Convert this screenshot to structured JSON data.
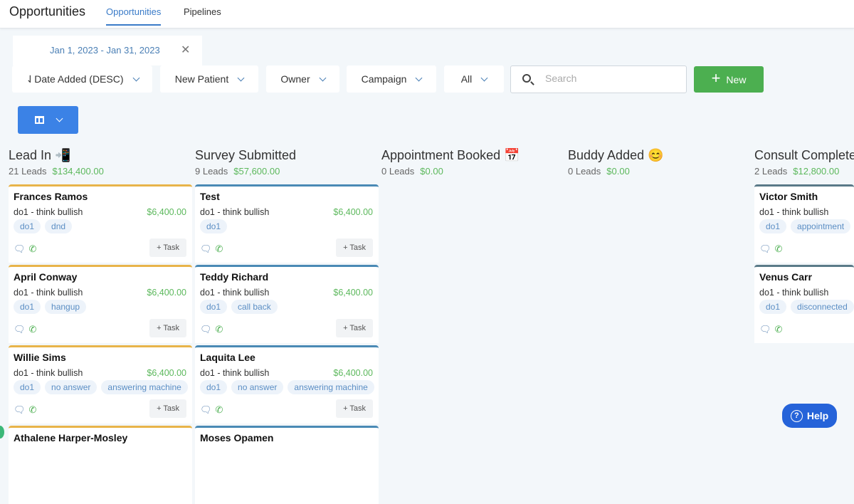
{
  "header": {
    "title": "Opportunities",
    "tabs": [
      {
        "label": "Opportunities"
      },
      {
        "label": "Pipelines"
      }
    ]
  },
  "date_filter": {
    "label": "Jan 1, 2023 - Jan 31, 2023",
    "clear_icon": "close-icon"
  },
  "filters": [
    {
      "label": "⇃Date Added (DESC)"
    },
    {
      "label": "New Patient"
    },
    {
      "label": "Owner"
    },
    {
      "label": "Campaign"
    },
    {
      "label": "All"
    }
  ],
  "search": {
    "placeholder": "Search",
    "value": ""
  },
  "new_button": {
    "label": "New",
    "icon": "+"
  },
  "help": {
    "label": "Help"
  },
  "colors": {
    "accent": "#3b82e6",
    "green": "#4caf50",
    "lead_in": "#e8b44a",
    "survey": "#4a8ab5",
    "consult": "#5a7a88"
  },
  "columns": [
    {
      "title": "Lead In 📲",
      "count": "21 Leads",
      "amount": "$134,400.00",
      "color": "#e8b44a",
      "cards": [
        {
          "name": "Frances Ramos",
          "sub": "do1 - think bullish",
          "value": "$6,400.00",
          "tags": [
            "do1",
            "dnd"
          ],
          "task": "+ Task"
        },
        {
          "name": "April Conway",
          "sub": "do1 - think bullish",
          "value": "$6,400.00",
          "tags": [
            "do1",
            "hangup"
          ],
          "task": "+ Task"
        },
        {
          "name": "Willie Sims",
          "sub": "do1 - think bullish",
          "value": "$6,400.00",
          "tags": [
            "do1",
            "no answer",
            "answering machine"
          ],
          "task": "+ Task"
        },
        {
          "name": "Athalene Harper-Mosley",
          "sub": "",
          "value": "",
          "tags": [],
          "task": ""
        }
      ]
    },
    {
      "title": "Survey Submitted",
      "count": "9 Leads",
      "amount": "$57,600.00",
      "color": "#4a8ab5",
      "cards": [
        {
          "name": "Test",
          "sub": "do1 - think bullish",
          "value": "$6,400.00",
          "tags": [
            "do1"
          ],
          "task": "+ Task"
        },
        {
          "name": "Teddy Richard",
          "sub": "do1 - think bullish",
          "value": "$6,400.00",
          "tags": [
            "do1",
            "call back"
          ],
          "task": "+ Task"
        },
        {
          "name": "Laquita Lee",
          "sub": "do1 - think bullish",
          "value": "$6,400.00",
          "tags": [
            "do1",
            "no answer",
            "answering machine"
          ],
          "task": "+ Task"
        },
        {
          "name": "Moses Opamen",
          "sub": "",
          "value": "",
          "tags": [],
          "task": ""
        }
      ]
    },
    {
      "title": "Appointment Booked 📅",
      "count": "0 Leads",
      "amount": "$0.00",
      "color": "#4a8ab5",
      "cards": []
    },
    {
      "title": "Buddy Added 😊",
      "count": "0 Leads",
      "amount": "$0.00",
      "color": "#4a8ab5",
      "cards": []
    },
    {
      "title": "Consult Completed",
      "count": "2 Leads",
      "amount": "$12,800.00",
      "color": "#5a7a88",
      "cards": [
        {
          "name": "Victor Smith",
          "sub": "do1 - think bullish",
          "value": "",
          "tags": [
            "do1",
            "appointment"
          ],
          "task": ""
        },
        {
          "name": "Venus Carr",
          "sub": "do1 - think bullish",
          "value": "",
          "tags": [
            "do1",
            "disconnected"
          ],
          "task": ""
        }
      ]
    }
  ]
}
